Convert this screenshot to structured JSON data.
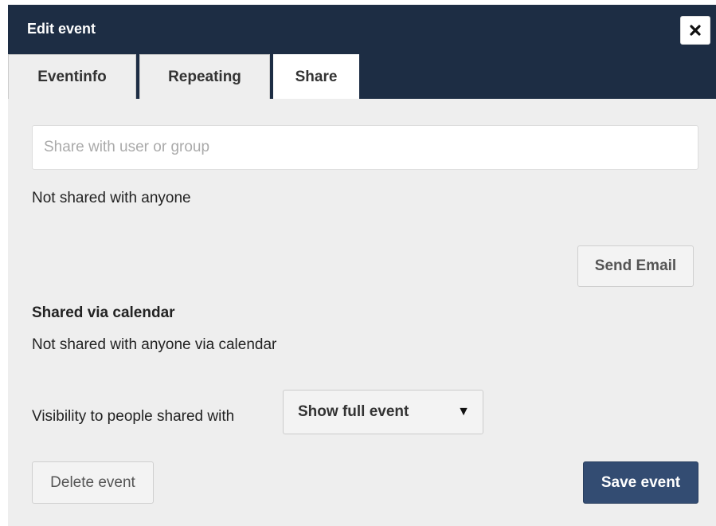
{
  "dialog": {
    "title": "Edit event",
    "close_icon": "close-icon"
  },
  "tabs": [
    {
      "label": "Eventinfo",
      "active": false
    },
    {
      "label": "Repeating",
      "active": false
    },
    {
      "label": "Share",
      "active": true
    }
  ],
  "share": {
    "input_value": "",
    "input_placeholder": "Share with user or group",
    "status_text": "Not shared with anyone",
    "send_email_label": "Send Email"
  },
  "calendar_share": {
    "heading": "Shared via calendar",
    "status_text": "Not shared with anyone via calendar"
  },
  "visibility": {
    "label": "Visibility to people shared with",
    "selected": "Show full event",
    "caret_icon": "caret-down-icon"
  },
  "footer": {
    "delete_label": "Delete event",
    "save_label": "Save event"
  },
  "colors": {
    "header_bg": "#1d2d44",
    "save_button_bg": "#334c72",
    "panel_bg": "#eeeeee"
  }
}
